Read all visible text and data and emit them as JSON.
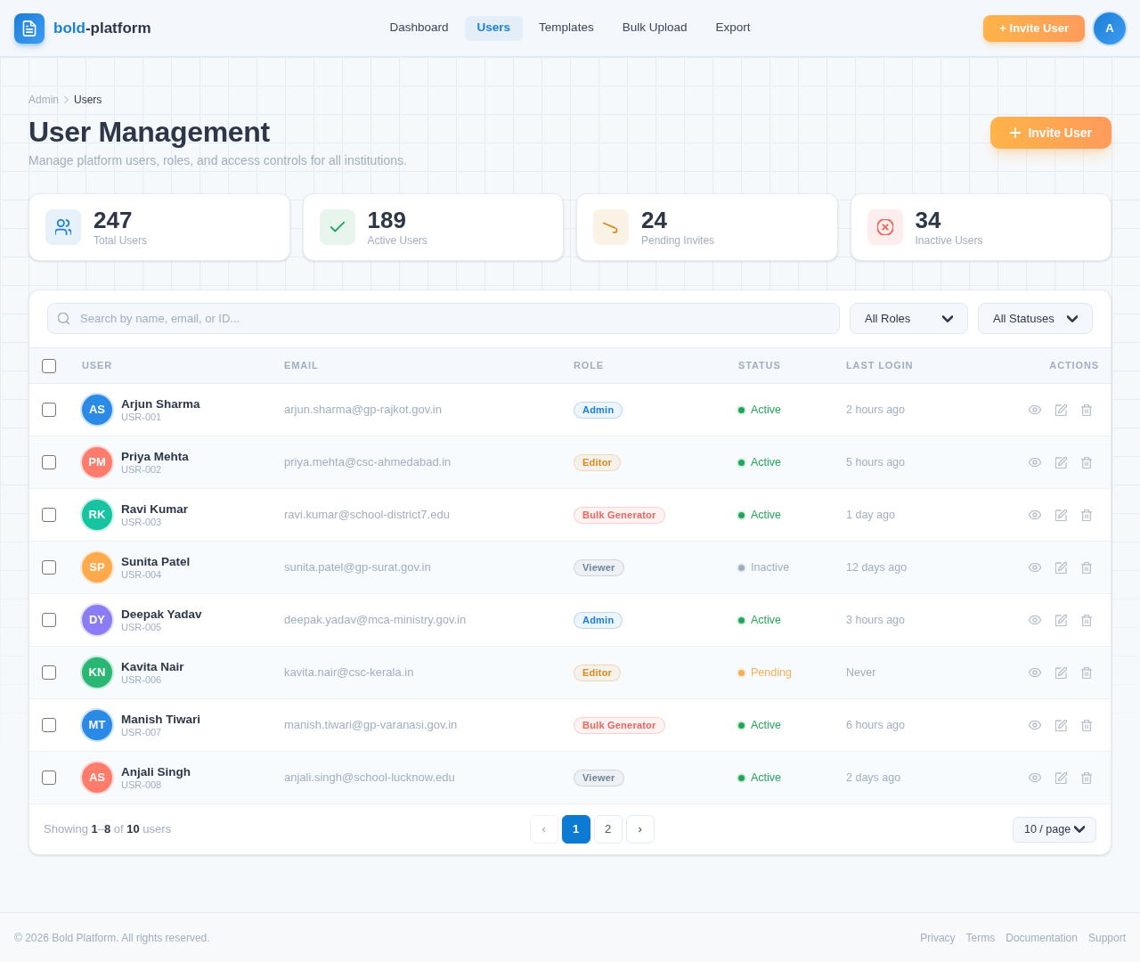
{
  "header": {
    "logo": {
      "accent": "bold",
      "rest": "-platform"
    },
    "nav": [
      {
        "label": "Dashboard",
        "selected": false
      },
      {
        "label": "Users",
        "selected": true
      },
      {
        "label": "Templates",
        "selected": false
      },
      {
        "label": "Bulk Upload",
        "selected": false
      },
      {
        "label": "Export",
        "selected": false
      }
    ],
    "invite_button": "+ Invite User",
    "avatar": "A"
  },
  "breadcrumb": [
    "Admin",
    "Users"
  ],
  "page": {
    "title": "User Management",
    "subtitle": "Manage platform users, roles, and access controls for all institutions.",
    "invite_button": "Invite User"
  },
  "stats": [
    {
      "value": "247",
      "label": "Total Users",
      "color": "#1a7fd6"
    },
    {
      "value": "189",
      "label": "Active Users",
      "color": "#22a55a"
    },
    {
      "value": "24",
      "label": "Pending Invites",
      "color": "#d98a1c"
    },
    {
      "value": "34",
      "label": "Inactive Users",
      "color": "#f0635a"
    }
  ],
  "filters": {
    "search": {
      "placeholder": "Search by name, email, or ID..."
    },
    "role": "All Roles",
    "status": "All Statuses"
  },
  "table": {
    "select_all": {
      "checked": false
    },
    "columns": [
      "USER",
      "EMAIL",
      "ROLE",
      "STATUS",
      "LAST LOGIN",
      "ACTIONS"
    ],
    "rows": [
      {
        "checked": false,
        "avatar": {
          "initials": "AS",
          "color": "#2b8ae6"
        },
        "name": "Arjun Sharma",
        "id": "USR-001",
        "email": "arjun.sharma@gp-rajkot.gov.in",
        "role": {
          "label": "Admin",
          "color": "#1a7fd6"
        },
        "status": {
          "label": "Active",
          "color": "#22a55a"
        },
        "last_login": "2 hours ago"
      },
      {
        "checked": false,
        "avatar": {
          "initials": "PM",
          "color": "#ff7b6b"
        },
        "name": "Priya Mehta",
        "id": "USR-002",
        "email": "priya.mehta@csc-ahmedabad.in",
        "role": {
          "label": "Editor",
          "color": "#d98a1c"
        },
        "status": {
          "label": "Active",
          "color": "#22a55a"
        },
        "last_login": "5 hours ago"
      },
      {
        "checked": false,
        "avatar": {
          "initials": "RK",
          "color": "#17c3a1"
        },
        "name": "Ravi Kumar",
        "id": "USR-003",
        "email": "ravi.kumar@school-district7.edu",
        "role": {
          "label": "Bulk Generator",
          "color": "#f0635a"
        },
        "status": {
          "label": "Active",
          "color": "#22a55a"
        },
        "last_login": "1 day ago"
      },
      {
        "checked": false,
        "avatar": {
          "initials": "SP",
          "color": "#ffa94d"
        },
        "name": "Sunita Patel",
        "id": "USR-004",
        "email": "sunita.patel@gp-surat.gov.in",
        "role": {
          "label": "Viewer",
          "color": "#718096"
        },
        "status": {
          "label": "Inactive",
          "color": "#a0aec0"
        },
        "last_login": "12 days ago"
      },
      {
        "checked": false,
        "avatar": {
          "initials": "DY",
          "color": "#8b7cf6"
        },
        "name": "Deepak Yadav",
        "id": "USR-005",
        "email": "deepak.yadav@mca-ministry.gov.in",
        "role": {
          "label": "Admin",
          "color": "#1a7fd6"
        },
        "status": {
          "label": "Active",
          "color": "#22a55a"
        },
        "last_login": "3 hours ago"
      },
      {
        "checked": false,
        "avatar": {
          "initials": "KN",
          "color": "#2ab673"
        },
        "name": "Kavita Nair",
        "id": "USR-006",
        "email": "kavita.nair@csc-kerala.in",
        "role": {
          "label": "Editor",
          "color": "#d98a1c"
        },
        "status": {
          "label": "Pending",
          "color": "#f6ad55"
        },
        "last_login": "Never"
      },
      {
        "checked": false,
        "avatar": {
          "initials": "MT",
          "color": "#2b8ae6"
        },
        "name": "Manish Tiwari",
        "id": "USR-007",
        "email": "manish.tiwari@gp-varanasi.gov.in",
        "role": {
          "label": "Bulk Generator",
          "color": "#f0635a"
        },
        "status": {
          "label": "Active",
          "color": "#22a55a"
        },
        "last_login": "6 hours ago"
      },
      {
        "checked": false,
        "avatar": {
          "initials": "AS",
          "color": "#ff7b6b"
        },
        "name": "Anjali Singh",
        "id": "USR-008",
        "email": "anjali.singh@school-lucknow.edu",
        "role": {
          "label": "Viewer",
          "color": "#718096"
        },
        "status": {
          "label": "Active",
          "color": "#22a55a"
        },
        "last_login": "2 days ago"
      }
    ]
  },
  "pagination": {
    "summary": "Showing **1**–**8** of **10** users",
    "prev": {
      "label": "‹",
      "disabled": true
    },
    "pages": [
      {
        "label": "1",
        "selected": true
      },
      {
        "label": "2",
        "selected": false
      }
    ],
    "next": {
      "label": "›",
      "disabled": false
    },
    "per_page": "10 / page"
  },
  "footer": {
    "copyright": "© 2026 Bold Platform. All rights reserved.",
    "links": [
      "Privacy",
      "Terms",
      "Documentation",
      "Support"
    ]
  }
}
